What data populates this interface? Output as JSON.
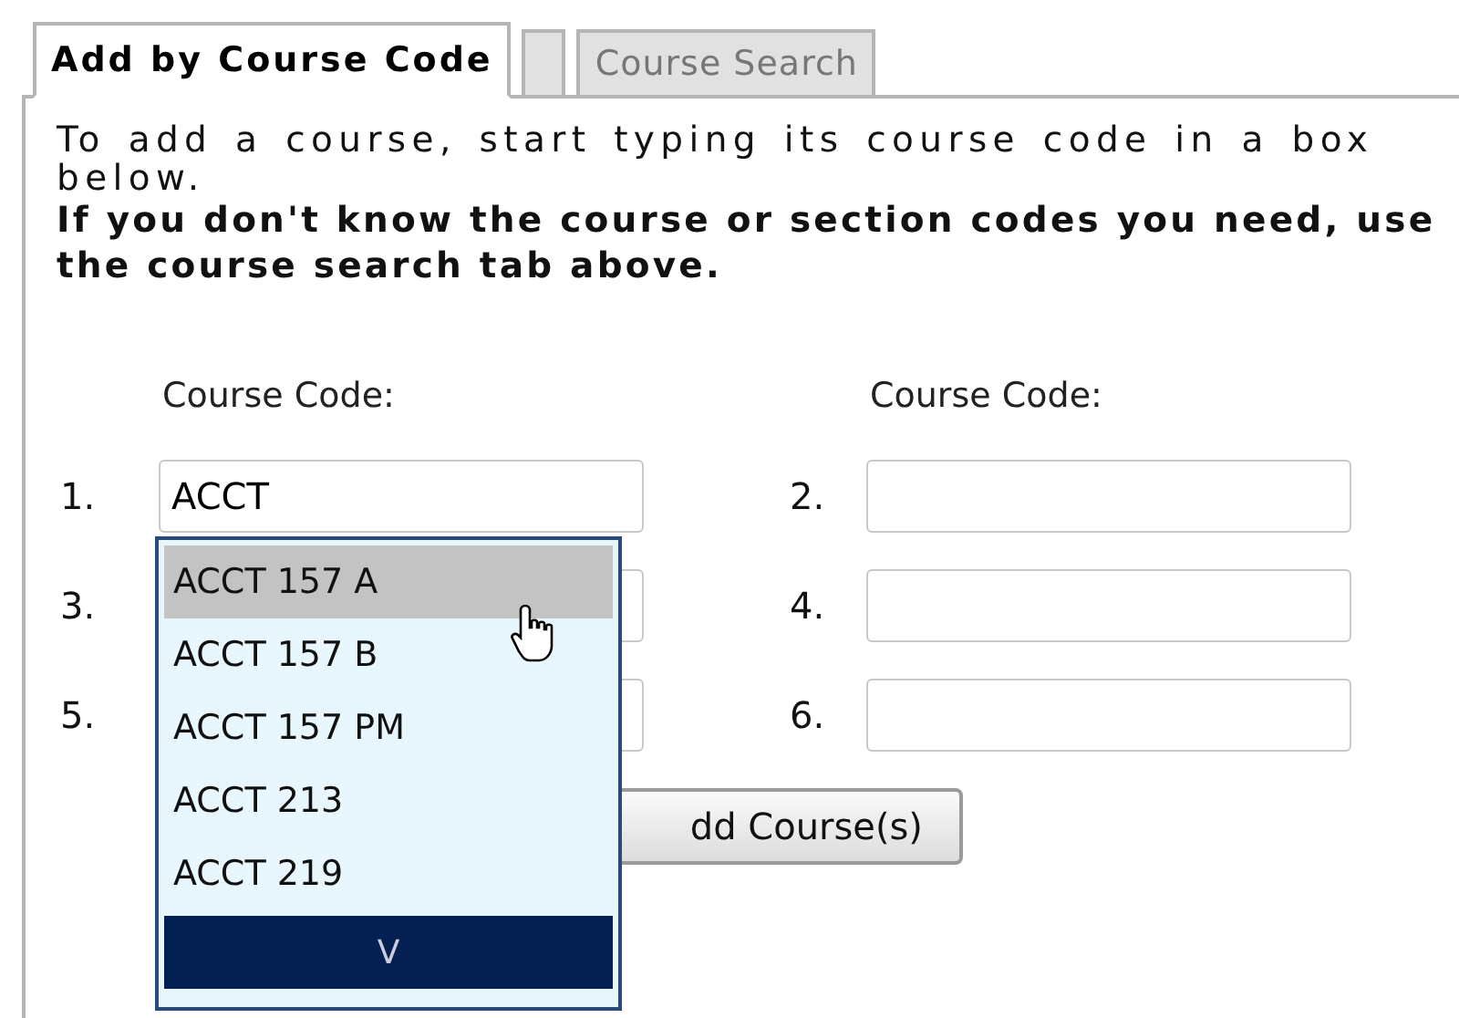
{
  "tabs": [
    {
      "label": "Add by Course Code",
      "selected": true
    },
    {
      "label": "Course Search",
      "selected": false
    }
  ],
  "instructions": {
    "text": "To add a course, start typing its course code in a box below.",
    "note": "If you don't know the course or section codes you need, use the course search tab above."
  },
  "column_headers": [
    "Course Code:",
    "Course Code:"
  ],
  "fields": [
    {
      "number": "1.",
      "value": "ACCT"
    },
    {
      "number": "2."
    },
    {
      "number": "3."
    },
    {
      "number": "4."
    },
    {
      "number": "5."
    },
    {
      "number": "6."
    }
  ],
  "button": {
    "label": "dd Course(s)"
  },
  "suggestions": {
    "items": [
      {
        "label": "ACCT 157 A",
        "selected": true
      },
      {
        "label": "ACCT 157 B",
        "selected": false
      },
      {
        "label": "ACCT 157 PM",
        "selected": false
      },
      {
        "label": "ACCT 213",
        "selected": false
      },
      {
        "label": "ACCT 219",
        "selected": false
      }
    ],
    "more": "V"
  }
}
